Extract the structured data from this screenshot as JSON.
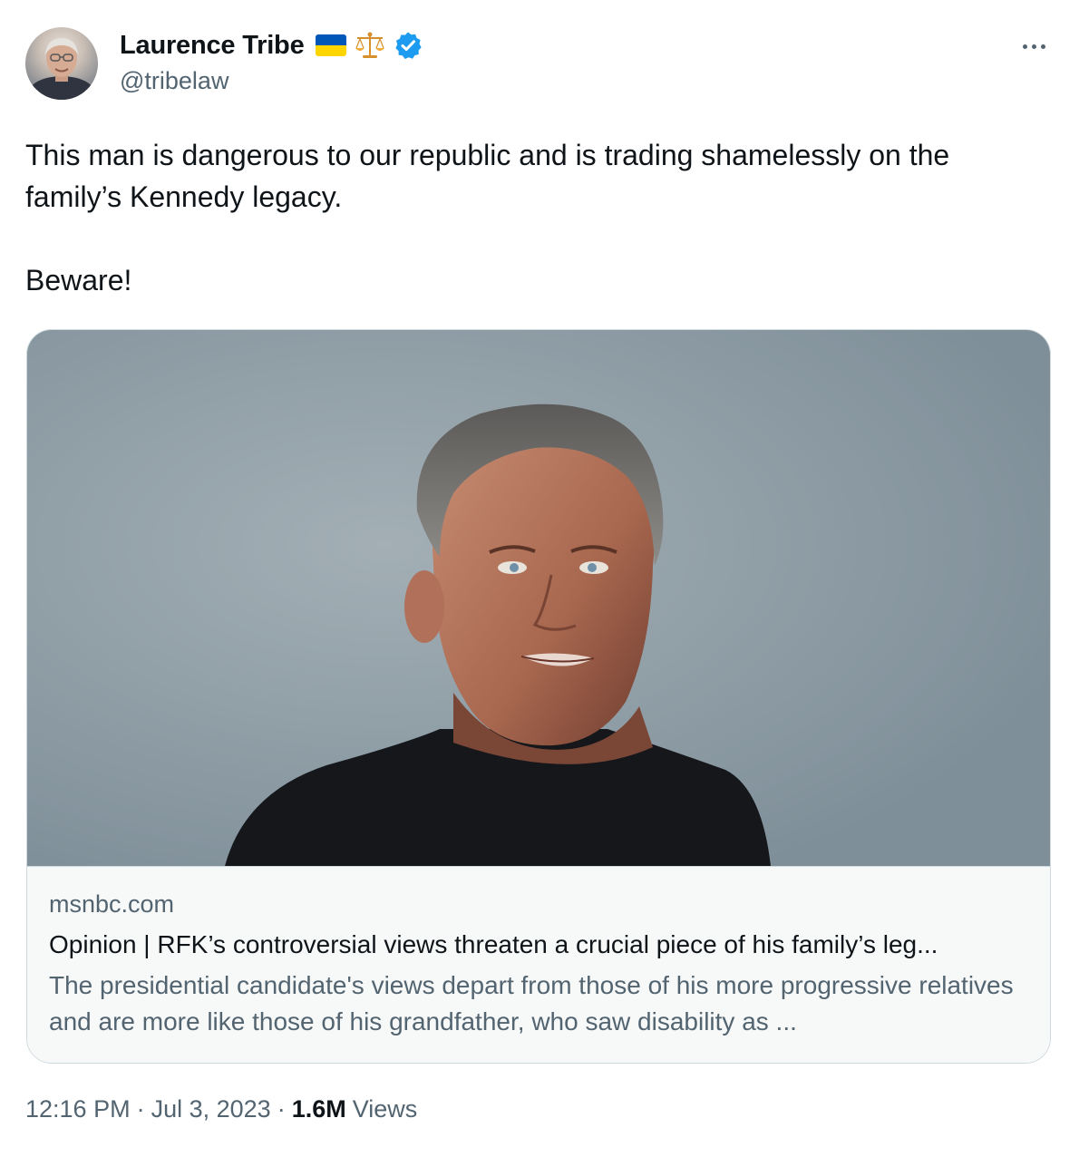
{
  "author": {
    "display_name": "Laurence Tribe",
    "handle": "@tribelaw",
    "badges": [
      "ukraine-flag-icon",
      "balance-scale-icon",
      "verified-badge-icon"
    ],
    "verified_color": "#1d9bf0"
  },
  "tweet": {
    "text": "This man is dangerous to our republic and is trading shamelessly on the family’s Kennedy legacy.\n\nBeware!"
  },
  "link_card": {
    "domain": "msnbc.com",
    "title": "Opinion | RFK’s controversial views threaten a crucial piece of his family’s leg...",
    "description": "The presidential candidate's views depart from those of his more progressive relatives and are more like those of his grandfather, who saw disability as ..."
  },
  "meta": {
    "time": "12:16 PM",
    "separator": "·",
    "date": "Jul 3, 2023",
    "views_count": "1.6M",
    "views_label": "Views"
  },
  "colors": {
    "text_primary": "#0f1419",
    "text_secondary": "#536471",
    "border": "#cfd9de",
    "card_background": "#f7f9f9",
    "photo_background": "#98a5ac"
  }
}
